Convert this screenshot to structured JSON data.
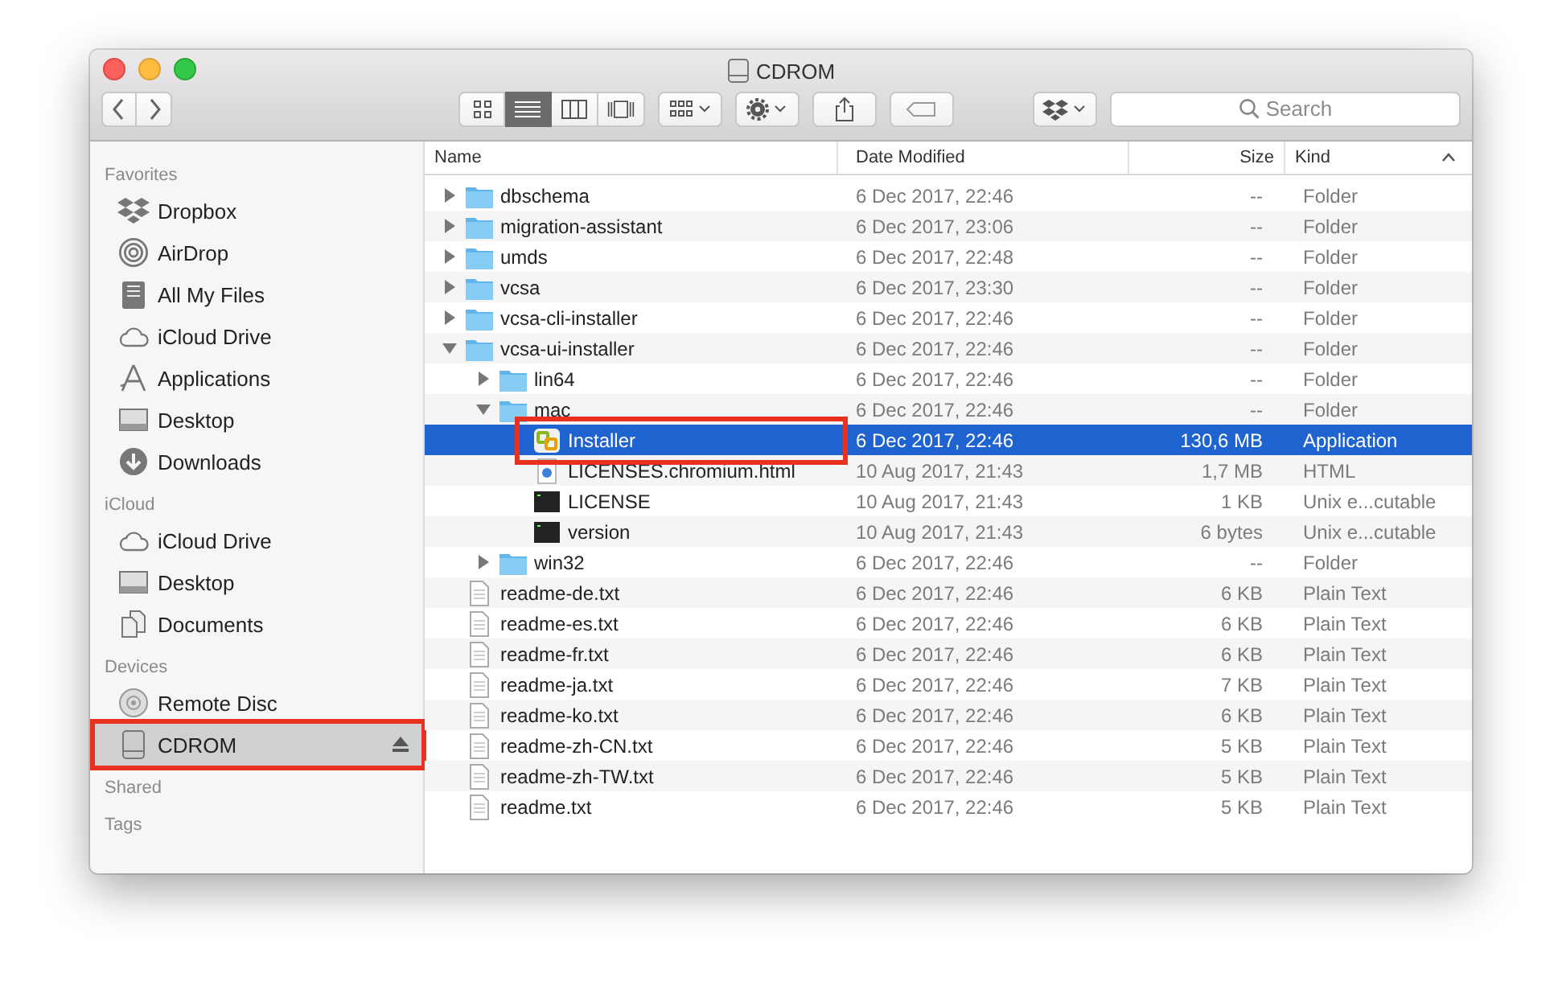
{
  "window": {
    "title": "CDROM"
  },
  "toolbar": {
    "view_modes": [
      {
        "kind": "icons",
        "selected": false
      },
      {
        "kind": "list",
        "selected": true
      },
      {
        "kind": "columns",
        "selected": false
      },
      {
        "kind": "coverflow",
        "selected": false
      }
    ],
    "search": {
      "placeholder": "Search"
    }
  },
  "sidebar": {
    "sections": [
      {
        "heading": "Favorites",
        "items": [
          {
            "label": "Dropbox",
            "kind": "dropbox",
            "selected": false,
            "annotated": false
          },
          {
            "label": "AirDrop",
            "kind": "airdrop",
            "selected": false,
            "annotated": false
          },
          {
            "label": "All My Files",
            "kind": "files",
            "selected": false,
            "annotated": false
          },
          {
            "label": "iCloud Drive",
            "kind": "cloud",
            "selected": false,
            "annotated": false
          },
          {
            "label": "Applications",
            "kind": "apps",
            "selected": false,
            "annotated": false
          },
          {
            "label": "Desktop",
            "kind": "desktop",
            "selected": false,
            "annotated": false
          },
          {
            "label": "Downloads",
            "kind": "downloads",
            "selected": false,
            "annotated": false
          }
        ]
      },
      {
        "heading": "iCloud",
        "items": [
          {
            "label": "iCloud Drive",
            "kind": "cloud",
            "selected": false,
            "annotated": false
          },
          {
            "label": "Desktop",
            "kind": "desktop",
            "selected": false,
            "annotated": false
          },
          {
            "label": "Documents",
            "kind": "docs",
            "selected": false,
            "annotated": false
          }
        ]
      },
      {
        "heading": "Devices",
        "items": [
          {
            "label": "Remote Disc",
            "kind": "disc",
            "selected": false,
            "annotated": false,
            "ejectable": false
          },
          {
            "label": "CDROM",
            "kind": "drive",
            "selected": true,
            "annotated": true,
            "ejectable": true
          }
        ]
      },
      {
        "heading": "Shared"
      },
      {
        "heading": "Tags"
      }
    ]
  },
  "files": {
    "columns": [
      {
        "label": "Name",
        "sorted": false
      },
      {
        "label": "Date Modified",
        "sorted": false
      },
      {
        "label": "Size",
        "sorted": false
      },
      {
        "label": "Kind",
        "sorted": true
      }
    ],
    "rows": [
      {
        "name": "dbschema",
        "kind": "folder",
        "expanded": false,
        "selected": false,
        "annotated": false,
        "date": "6 Dec 2017, 22:46",
        "size": "--",
        "type": "Folder"
      },
      {
        "name": "migration-assistant",
        "kind": "folder",
        "expanded": false,
        "selected": false,
        "annotated": false,
        "date": "6 Dec 2017, 23:06",
        "size": "--",
        "type": "Folder"
      },
      {
        "name": "umds",
        "kind": "folder",
        "expanded": false,
        "selected": false,
        "annotated": false,
        "date": "6 Dec 2017, 22:48",
        "size": "--",
        "type": "Folder"
      },
      {
        "name": "vcsa",
        "kind": "folder",
        "expanded": false,
        "selected": false,
        "annotated": false,
        "date": "6 Dec 2017, 23:30",
        "size": "--",
        "type": "Folder"
      },
      {
        "name": "vcsa-cli-installer",
        "kind": "folder",
        "expanded": false,
        "selected": false,
        "annotated": false,
        "date": "6 Dec 2017, 22:46",
        "size": "--",
        "type": "Folder"
      },
      {
        "name": "vcsa-ui-installer",
        "kind": "folder",
        "expanded": true,
        "selected": false,
        "annotated": false,
        "date": "6 Dec 2017, 22:46",
        "size": "--",
        "type": "Folder",
        "children": [
          {
            "name": "lin64",
            "kind": "folder",
            "expanded": false,
            "selected": false,
            "annotated": false,
            "date": "6 Dec 2017, 22:46",
            "size": "--",
            "type": "Folder"
          },
          {
            "name": "mac",
            "kind": "folder",
            "expanded": true,
            "selected": false,
            "annotated": false,
            "date": "6 Dec 2017, 22:46",
            "size": "--",
            "type": "Folder",
            "children": [
              {
                "name": "Installer",
                "kind": "app",
                "selected": true,
                "annotated": true,
                "date": "6 Dec 2017, 22:46",
                "size": "130,6 MB",
                "type": "Application"
              },
              {
                "name": "LICENSES.chromium.html",
                "kind": "html",
                "selected": false,
                "annotated": false,
                "date": "10 Aug 2017, 21:43",
                "size": "1,7 MB",
                "type": "HTML"
              },
              {
                "name": "LICENSE",
                "kind": "exec",
                "selected": false,
                "annotated": false,
                "date": "10 Aug 2017, 21:43",
                "size": "1 KB",
                "type": "Unix e...cutable"
              },
              {
                "name": "version",
                "kind": "exec",
                "selected": false,
                "annotated": false,
                "date": "10 Aug 2017, 21:43",
                "size": "6 bytes",
                "type": "Unix e...cutable"
              }
            ]
          },
          {
            "name": "win32",
            "kind": "folder",
            "expanded": false,
            "selected": false,
            "annotated": false,
            "date": "6 Dec 2017, 22:46",
            "size": "--",
            "type": "Folder"
          }
        ]
      },
      {
        "name": "readme-de.txt",
        "kind": "text",
        "selected": false,
        "annotated": false,
        "date": "6 Dec 2017, 22:46",
        "size": "6 KB",
        "type": "Plain Text"
      },
      {
        "name": "readme-es.txt",
        "kind": "text",
        "selected": false,
        "annotated": false,
        "date": "6 Dec 2017, 22:46",
        "size": "6 KB",
        "type": "Plain Text"
      },
      {
        "name": "readme-fr.txt",
        "kind": "text",
        "selected": false,
        "annotated": false,
        "date": "6 Dec 2017, 22:46",
        "size": "6 KB",
        "type": "Plain Text"
      },
      {
        "name": "readme-ja.txt",
        "kind": "text",
        "selected": false,
        "annotated": false,
        "date": "6 Dec 2017, 22:46",
        "size": "7 KB",
        "type": "Plain Text"
      },
      {
        "name": "readme-ko.txt",
        "kind": "text",
        "selected": false,
        "annotated": false,
        "date": "6 Dec 2017, 22:46",
        "size": "6 KB",
        "type": "Plain Text"
      },
      {
        "name": "readme-zh-CN.txt",
        "kind": "text",
        "selected": false,
        "annotated": false,
        "date": "6 Dec 2017, 22:46",
        "size": "5 KB",
        "type": "Plain Text"
      },
      {
        "name": "readme-zh-TW.txt",
        "kind": "text",
        "selected": false,
        "annotated": false,
        "date": "6 Dec 2017, 22:46",
        "size": "5 KB",
        "type": "Plain Text"
      },
      {
        "name": "readme.txt",
        "kind": "text",
        "selected": false,
        "annotated": false,
        "date": "6 Dec 2017, 22:46",
        "size": "5 KB",
        "type": "Plain Text"
      }
    ]
  }
}
